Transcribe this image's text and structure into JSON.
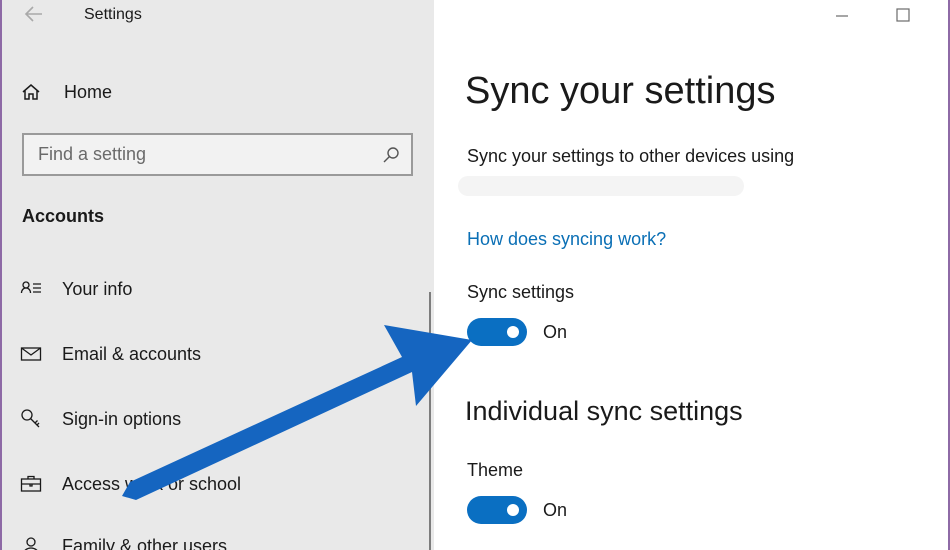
{
  "window": {
    "title": "Settings"
  },
  "sidebar": {
    "home_label": "Home",
    "search_placeholder": "Find a setting",
    "section_title": "Accounts",
    "items": [
      {
        "label": "Your info",
        "icon": "person-card-icon"
      },
      {
        "label": "Email & accounts",
        "icon": "mail-icon"
      },
      {
        "label": "Sign-in options",
        "icon": "key-icon"
      },
      {
        "label": "Access work or school",
        "icon": "briefcase-icon"
      },
      {
        "label": "Family & other users",
        "icon": "person-icon"
      }
    ]
  },
  "main": {
    "title": "Sync your settings",
    "description": "Sync your settings to other devices using",
    "link": "How does syncing work?",
    "sync_settings": {
      "label": "Sync settings",
      "state": "On",
      "enabled": true
    },
    "section_title": "Individual sync settings",
    "theme": {
      "label": "Theme",
      "state": "On",
      "enabled": true
    }
  },
  "colors": {
    "accent": "#0a6fc2",
    "link": "#0a6fb5",
    "annotation_arrow": "#1565c0",
    "sidebar_bg": "#e9e9e9"
  }
}
